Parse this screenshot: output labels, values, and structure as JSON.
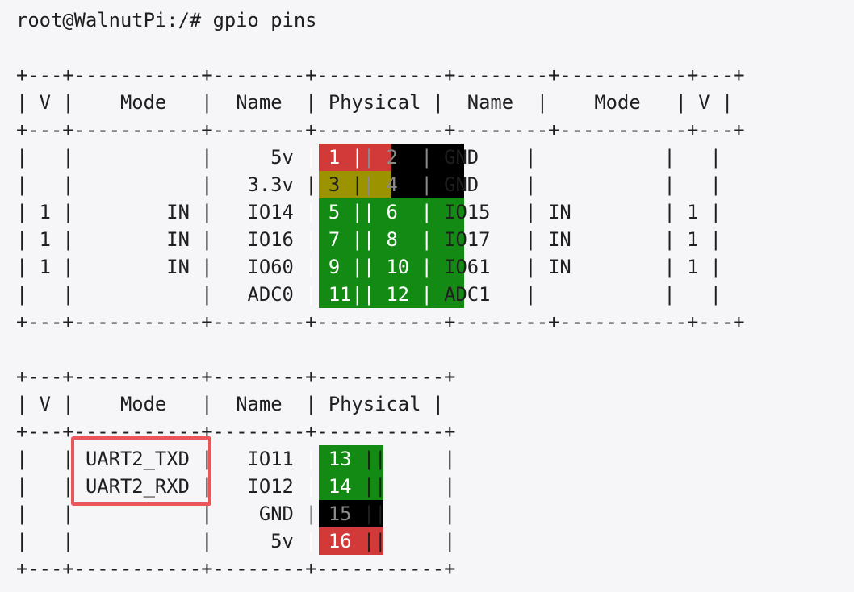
{
  "terminal": {
    "prompt": "root@WalnutPi:/# ",
    "command": "gpio pins"
  },
  "colors": {
    "background": "#f6f6f8",
    "text": "#1f1f1f",
    "red_5v": "#d23a3a",
    "olive_3v3": "#9b9300",
    "black_gnd": "#000000",
    "green_io": "#138a13",
    "highlight_box": "#e9575a"
  },
  "table1": {
    "border": "+---+-----------+--------+-----------+--------+-----------+---+",
    "header": "| V |    Mode   |  Name  | Physical |  Name  |    Mode   | V |",
    "rows": [
      {
        "prefix": "|   |           |     5v ",
        "left_pin": "| 1 |",
        "left_color": "red",
        "right_pin": "| 2  |",
        "right_color": "black",
        "suffix": " GND    |           |   |"
      },
      {
        "prefix": "|   |           |   3.3v ",
        "left_pin": "| 3 |",
        "left_color": "olive",
        "right_pin": "| 4  |",
        "right_color": "black",
        "suffix": " GND    |           |   |"
      },
      {
        "prefix": "| 1 |        IN |   IO14 ",
        "left_pin": "| 5 |",
        "left_color": "green",
        "right_pin": "| 6  |",
        "right_color": "green",
        "suffix": " IO15   | IN        | 1 |"
      },
      {
        "prefix": "| 1 |        IN |   IO16 ",
        "left_pin": "| 7 |",
        "left_color": "green",
        "right_pin": "| 8  |",
        "right_color": "green",
        "suffix": " IO17   | IN        | 1 |"
      },
      {
        "prefix": "| 1 |        IN |   IO60 ",
        "left_pin": "| 9 |",
        "left_color": "green",
        "right_pin": "| 10 |",
        "right_color": "green",
        "suffix": " IO61   | IN        | 1 |"
      },
      {
        "prefix": "|   |           |   ADC0 ",
        "left_pin": "| 11|",
        "left_color": "green",
        "right_pin": "| 12 |",
        "right_color": "green",
        "suffix": " ADC1   |           |   |"
      }
    ]
  },
  "table2": {
    "border": "+---+-----------+--------+-----------+",
    "header": "| V |    Mode   |  Name  | Physical |",
    "rows": [
      {
        "prefix": "|   | UART2_TXD |   IO11 ",
        "pin": "| 13",
        "pin_color": "green",
        "suffix": " ||     |"
      },
      {
        "prefix": "|   | UART2_RXD |   IO12 ",
        "pin": "| 14",
        "pin_color": "green",
        "suffix": " ||     |"
      },
      {
        "prefix": "|   |           |    GND ",
        "pin": "| 15",
        "pin_color": "black",
        "suffix": " ||     |"
      },
      {
        "prefix": "|   |           |     5v ",
        "pin": "| 16",
        "pin_color": "red",
        "suffix": " ||     |"
      }
    ]
  }
}
